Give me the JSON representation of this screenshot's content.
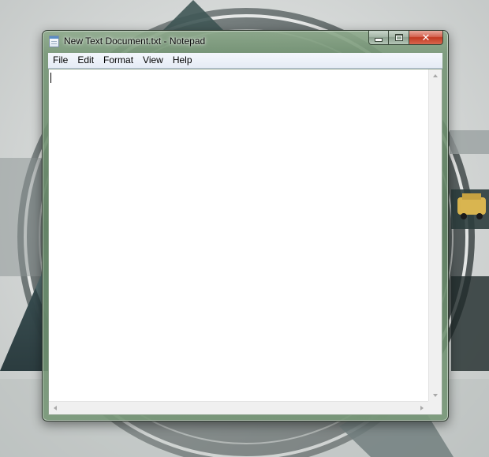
{
  "window": {
    "title": "New Text Document.txt - Notepad",
    "icon": "notepad-icon"
  },
  "caption_buttons": {
    "minimize_icon": "minimize-icon",
    "maximize_icon": "maximize-icon",
    "close_icon": "close-icon",
    "close_glyph": "✕"
  },
  "menu": {
    "items": [
      {
        "label": "File"
      },
      {
        "label": "Edit"
      },
      {
        "label": "Format"
      },
      {
        "label": "View"
      },
      {
        "label": "Help"
      }
    ]
  },
  "editor": {
    "content": ""
  },
  "colors": {
    "window_glass": "#7a9a7b",
    "close_button": "#c94a32",
    "menu_bar": "#eaeff7"
  }
}
